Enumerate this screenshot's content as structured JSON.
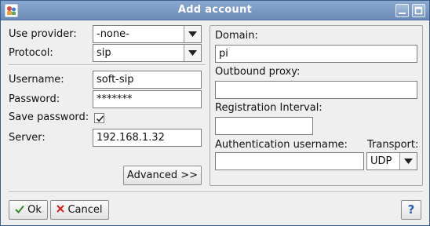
{
  "window": {
    "title": "Add account",
    "icon": "app-icon",
    "minimize_icon": "minimize-icon",
    "maximize_icon": "maximize-icon"
  },
  "left": {
    "use_provider": {
      "label": "Use provider:",
      "value": "-none-"
    },
    "protocol": {
      "label": "Protocol:",
      "value": "sip"
    },
    "username": {
      "label": "Username:",
      "value": "soft-sip"
    },
    "password": {
      "label": "Password:",
      "value": "*******"
    },
    "save_password": {
      "label": "Save password:",
      "checked": true
    },
    "server": {
      "label": "Server:",
      "value": "192.168.1.32"
    },
    "advanced_button": "Advanced >>"
  },
  "right": {
    "domain": {
      "label": "Domain:",
      "value": "pi"
    },
    "outbound_proxy": {
      "label": "Outbound proxy:",
      "value": ""
    },
    "registration_interval": {
      "label": "Registration Interval:",
      "value": ""
    },
    "auth_username": {
      "label": "Authentication username:",
      "value": ""
    },
    "transport": {
      "label": "Transport:",
      "value": "UDP"
    }
  },
  "footer": {
    "ok_button": "Ok",
    "cancel_button": "Cancel",
    "help_button": "?"
  },
  "colors": {
    "titlebar": "#7897c2",
    "ok_check": "#2e8b2e",
    "cancel_x": "#cc2222",
    "help": "#2b5fb0"
  }
}
